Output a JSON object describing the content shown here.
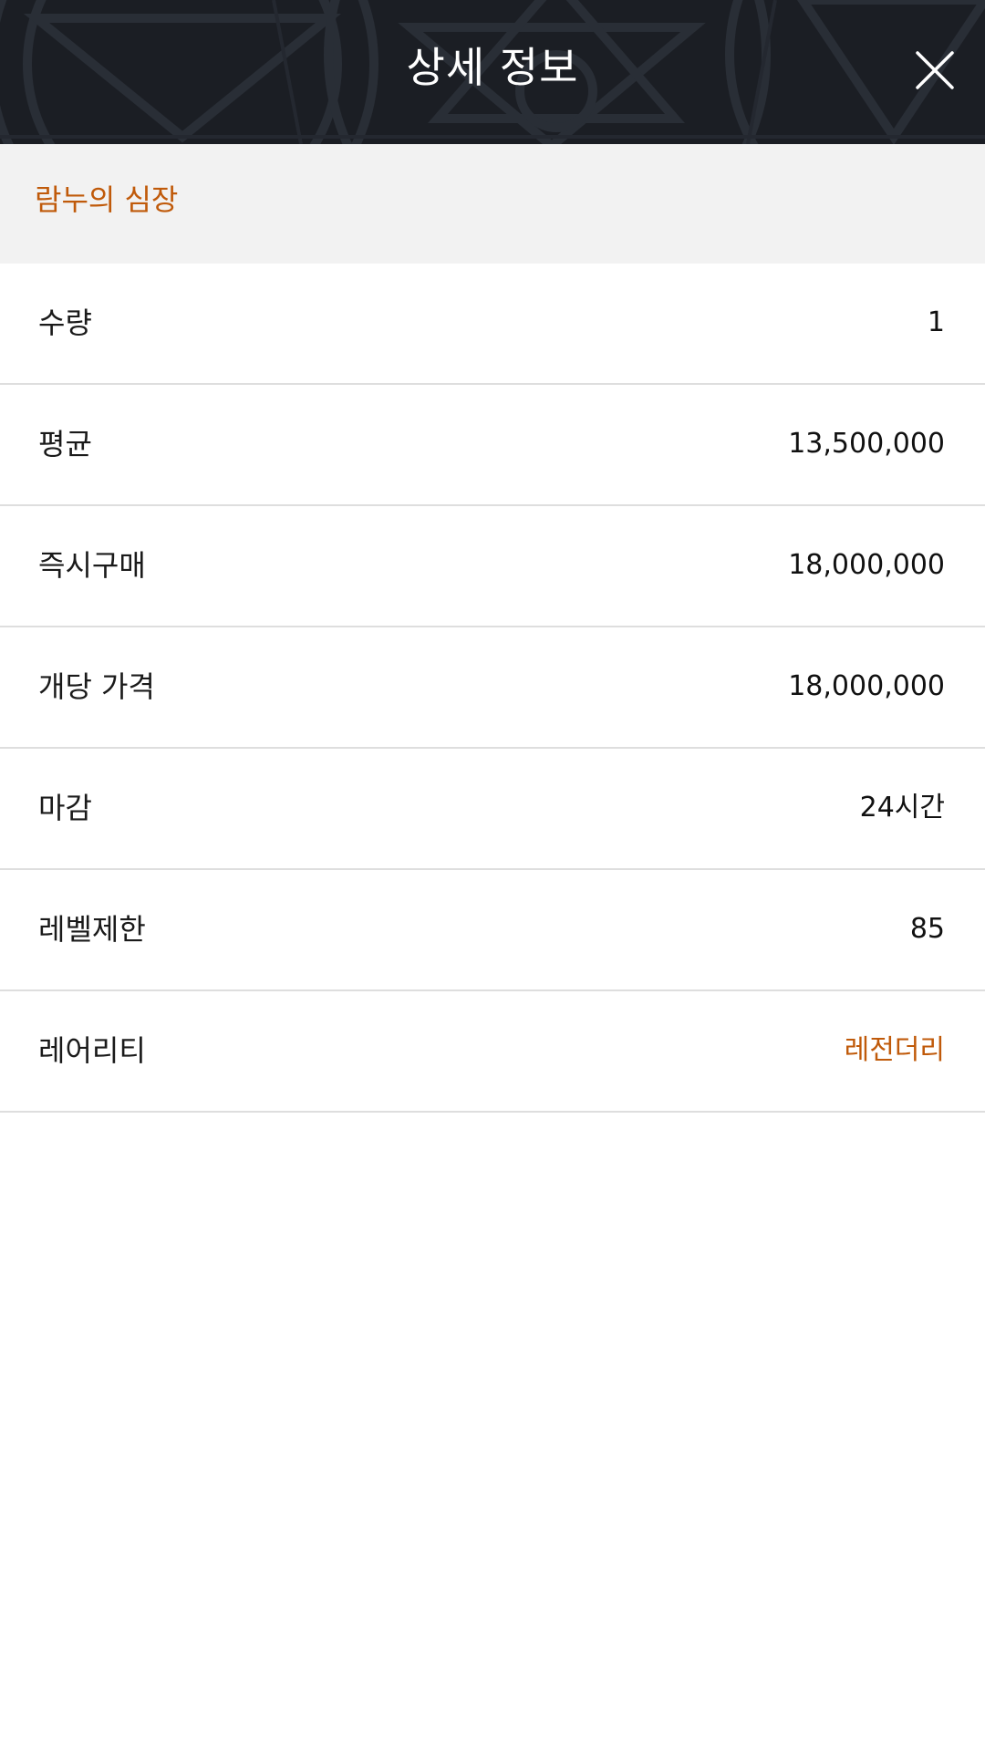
{
  "header": {
    "title": "상세 정보",
    "close_icon": "close-icon"
  },
  "item": {
    "name": "람누의 심장"
  },
  "colors": {
    "header_bg": "#1b1e24",
    "accent": "#c05a0a",
    "band_bg": "#f2f2f2",
    "divider": "#dedede"
  },
  "details": [
    {
      "label": "수량",
      "value": "1"
    },
    {
      "label": "평균",
      "value": "13,500,000"
    },
    {
      "label": "즉시구매",
      "value": "18,000,000"
    },
    {
      "label": "개당 가격",
      "value": "18,000,000"
    },
    {
      "label": "마감",
      "value": "24시간"
    },
    {
      "label": "레벨제한",
      "value": "85"
    },
    {
      "label": "레어리티",
      "value": "레전더리"
    }
  ]
}
